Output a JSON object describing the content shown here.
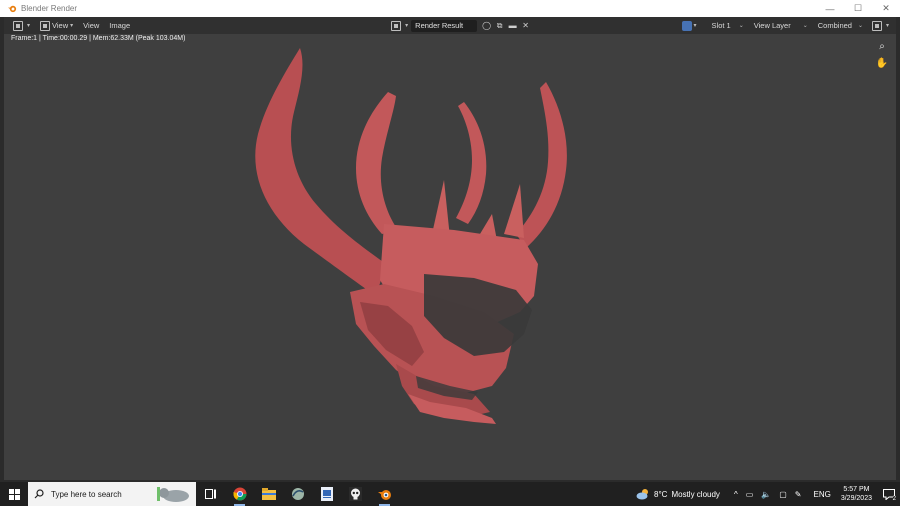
{
  "window": {
    "title": "Blender Render",
    "minimize": "—",
    "maximize": "☐",
    "close": "✕"
  },
  "header": {
    "view_menu": "View",
    "view_tab": "View",
    "image_tab": "Image",
    "image_name": "Render Result",
    "slot": "Slot 1",
    "view_layer": "View Layer",
    "pass": "Combined"
  },
  "viewport": {
    "info": "Frame:1 | Time:00:00.29 | Mem:62.33M (Peak 103.04M)",
    "background_color": "#3f3f3f",
    "model_color": "#c45a5c"
  },
  "taskbar": {
    "search_placeholder": "Type here to search",
    "weather_temp": "8°C",
    "weather_desc": "Mostly cloudy",
    "language": "ENG",
    "time": "5:57 PM",
    "date": "3/29/2023",
    "notification_count": "2"
  },
  "colors": {
    "accent": "#4772b3",
    "taskbar": "#202020"
  }
}
